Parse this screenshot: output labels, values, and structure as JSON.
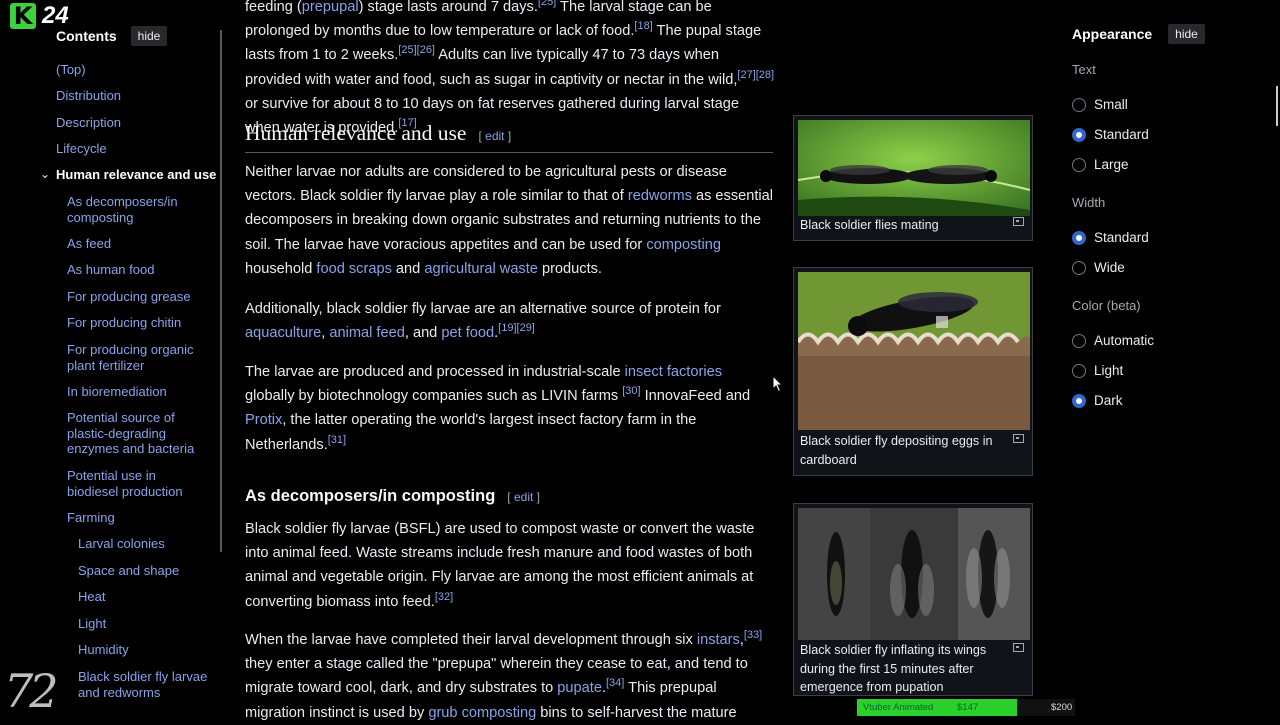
{
  "logo": {
    "letter": "K",
    "number": "24"
  },
  "toc": {
    "title": "Contents",
    "hide_label": "hide",
    "items": [
      {
        "label": "(Top)"
      },
      {
        "label": "Distribution"
      },
      {
        "label": "Description"
      },
      {
        "label": "Lifecycle"
      },
      {
        "label": "Human relevance and use"
      },
      {
        "label": "As decomposers/in composting"
      },
      {
        "label": "As feed"
      },
      {
        "label": "As human food"
      },
      {
        "label": "For producing grease"
      },
      {
        "label": "For producing chitin"
      },
      {
        "label": "For producing organic plant fertilizer"
      },
      {
        "label": "In bioremediation"
      },
      {
        "label": "Potential source of plastic-degrading enzymes and bacteria"
      },
      {
        "label": "Potential use in biodiesel production"
      },
      {
        "label": "Farming"
      },
      {
        "label": "Larval colonies"
      },
      {
        "label": "Space and shape"
      },
      {
        "label": "Heat"
      },
      {
        "label": "Light"
      },
      {
        "label": "Humidity"
      },
      {
        "label": "Black soldier fly larvae and redworms"
      }
    ]
  },
  "article": {
    "intro": {
      "t1": "feeding (",
      "l1": "prepupal",
      "t2": ") stage lasts around 7 days.",
      "s1": "[25]",
      "t3": " The larval stage can be prolonged by months due to low temperature or lack of food.",
      "s2": "[18]",
      "t4": " The pupal stage lasts from 1 to 2 weeks.",
      "s3": "[25][26]",
      "t5": " Adults can live typically 47 to 73 days when provided with water and food, such as sugar in captivity or nectar in the wild,",
      "s4": "[27][28]",
      "t6": " or survive for about 8 to 10 days on fat reserves gathered during larval stage when water is provided.",
      "s5": "[17]"
    },
    "section": {
      "title": "Human relevance and use",
      "edit_open": "[ ",
      "edit": "edit",
      "edit_close": " ]"
    },
    "p1": {
      "t1": "Neither larvae nor adults are considered to be agricultural pests or disease vectors. Black soldier fly larvae play a role similar to that of ",
      "l1": "redworms",
      "t2": " as essential decomposers in breaking down organic substrates and returning nutrients to the soil. The larvae have voracious appetites and can be used for ",
      "l2": "composting",
      "t3": " household ",
      "l3": "food scraps",
      "t4": " and ",
      "l4": "agricultural waste",
      "t5": " products."
    },
    "p2": {
      "t1": "Additionally, black soldier fly larvae are an alternative source of protein for ",
      "l1": "aquaculture",
      "t2": ", ",
      "l2": "animal feed",
      "t3": ", and ",
      "l3": "pet food",
      "t4": ".",
      "s1": "[19][29]"
    },
    "p3": {
      "t1": "The larvae are produced and processed in industrial-scale ",
      "l1": "insect factories",
      "t2": " globally by biotechnology companies such as LIVIN farms ",
      "s1": "[30]",
      "t3": " InnovaFeed and ",
      "l2": "Protix",
      "t4": ", the latter operating the world's largest insect factory farm in the Netherlands.",
      "s2": "[31]"
    },
    "subsection": {
      "title": "As decomposers/in composting",
      "edit_open": "[ ",
      "edit": "edit",
      "edit_close": " ]"
    },
    "p4": {
      "t1": "Black soldier fly larvae (BSFL) are used to compost waste or convert the waste into animal feed. Waste streams include fresh manure and food wastes of both animal and vegetable origin. Fly larvae are among the most efficient animals at converting biomass into feed.",
      "s1": "[32]"
    },
    "p5": {
      "t1": "When the larvae have completed their larval development through six ",
      "l1": "instars",
      "t2": ",",
      "s1": "[33]",
      "t3": " they enter a stage called the \"prepupa\" wherein they cease to eat, and tend to migrate toward cool, dark, and dry substrates to ",
      "l2": "pupate",
      "t4": ".",
      "s2": "[34]",
      "t5": " This prepupal migration instinct is used by ",
      "l3": "grub composting",
      "t6": " bins to self-harvest the mature"
    }
  },
  "figures": [
    {
      "caption": "Black soldier flies mating"
    },
    {
      "caption": "Black soldier fly depositing eggs in cardboard"
    },
    {
      "caption": "Black soldier fly inflating its wings during the first 15 minutes after emergence from pupation"
    }
  ],
  "appearance": {
    "title": "Appearance",
    "hide_label": "hide",
    "text_label": "Text",
    "text_options": [
      {
        "label": "Small",
        "selected": false
      },
      {
        "label": "Standard",
        "selected": true
      },
      {
        "label": "Large",
        "selected": false
      }
    ],
    "width_label": "Width",
    "width_options": [
      {
        "label": "Standard",
        "selected": true
      },
      {
        "label": "Wide",
        "selected": false
      }
    ],
    "color_label": "Color (beta)",
    "color_options": [
      {
        "label": "Automatic",
        "selected": false
      },
      {
        "label": "Light",
        "selected": false
      },
      {
        "label": "Dark",
        "selected": true
      }
    ]
  },
  "overlay": {
    "watermark": "72",
    "donation_label": "Vtuber Animated",
    "donation_current": "$147",
    "donation_goal": "$200",
    "donation_progress": 0.735
  },
  "colors": {
    "background": "#000000",
    "link": "#88a3e8",
    "text": "#eaecf0",
    "radio_selected": "#3366cc",
    "logo_green": "#3ad33a"
  }
}
